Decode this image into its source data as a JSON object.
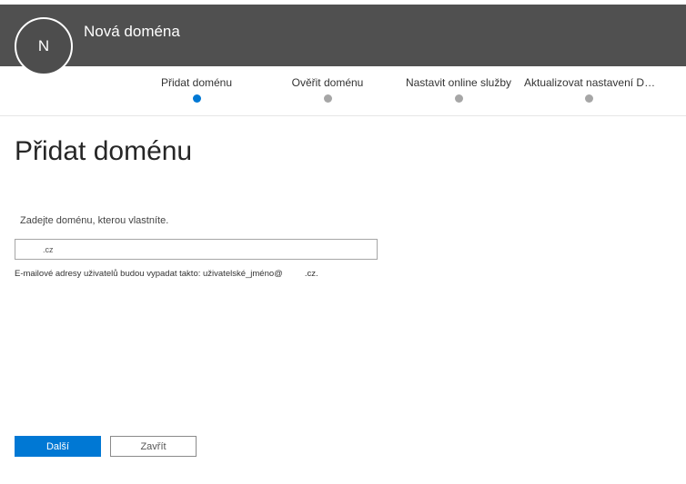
{
  "header": {
    "avatar_initial": "N",
    "title": "Nová doména"
  },
  "steps": [
    {
      "label": "Přidat doménu",
      "state": "active"
    },
    {
      "label": "Ověřit doménu",
      "state": "pending"
    },
    {
      "label": "Nastavit online služby",
      "state": "pending"
    },
    {
      "label": "Aktualizovat nastavení D…",
      "state": "pending"
    }
  ],
  "main": {
    "title": "Přidat doménu",
    "prompt": "Zadejte doménu, kterou vlastníte.",
    "domain_value": ".cz",
    "hint_prefix": "E-mailové adresy uživatelů budou vypadat takto: uživatelské_jméno@",
    "hint_suffix": ".cz."
  },
  "buttons": {
    "next_label": "Další",
    "close_label": "Zavřít"
  },
  "colors": {
    "header_bg": "#505050",
    "accent": "#0078d4",
    "inactive_dot": "#a6a6a6"
  }
}
